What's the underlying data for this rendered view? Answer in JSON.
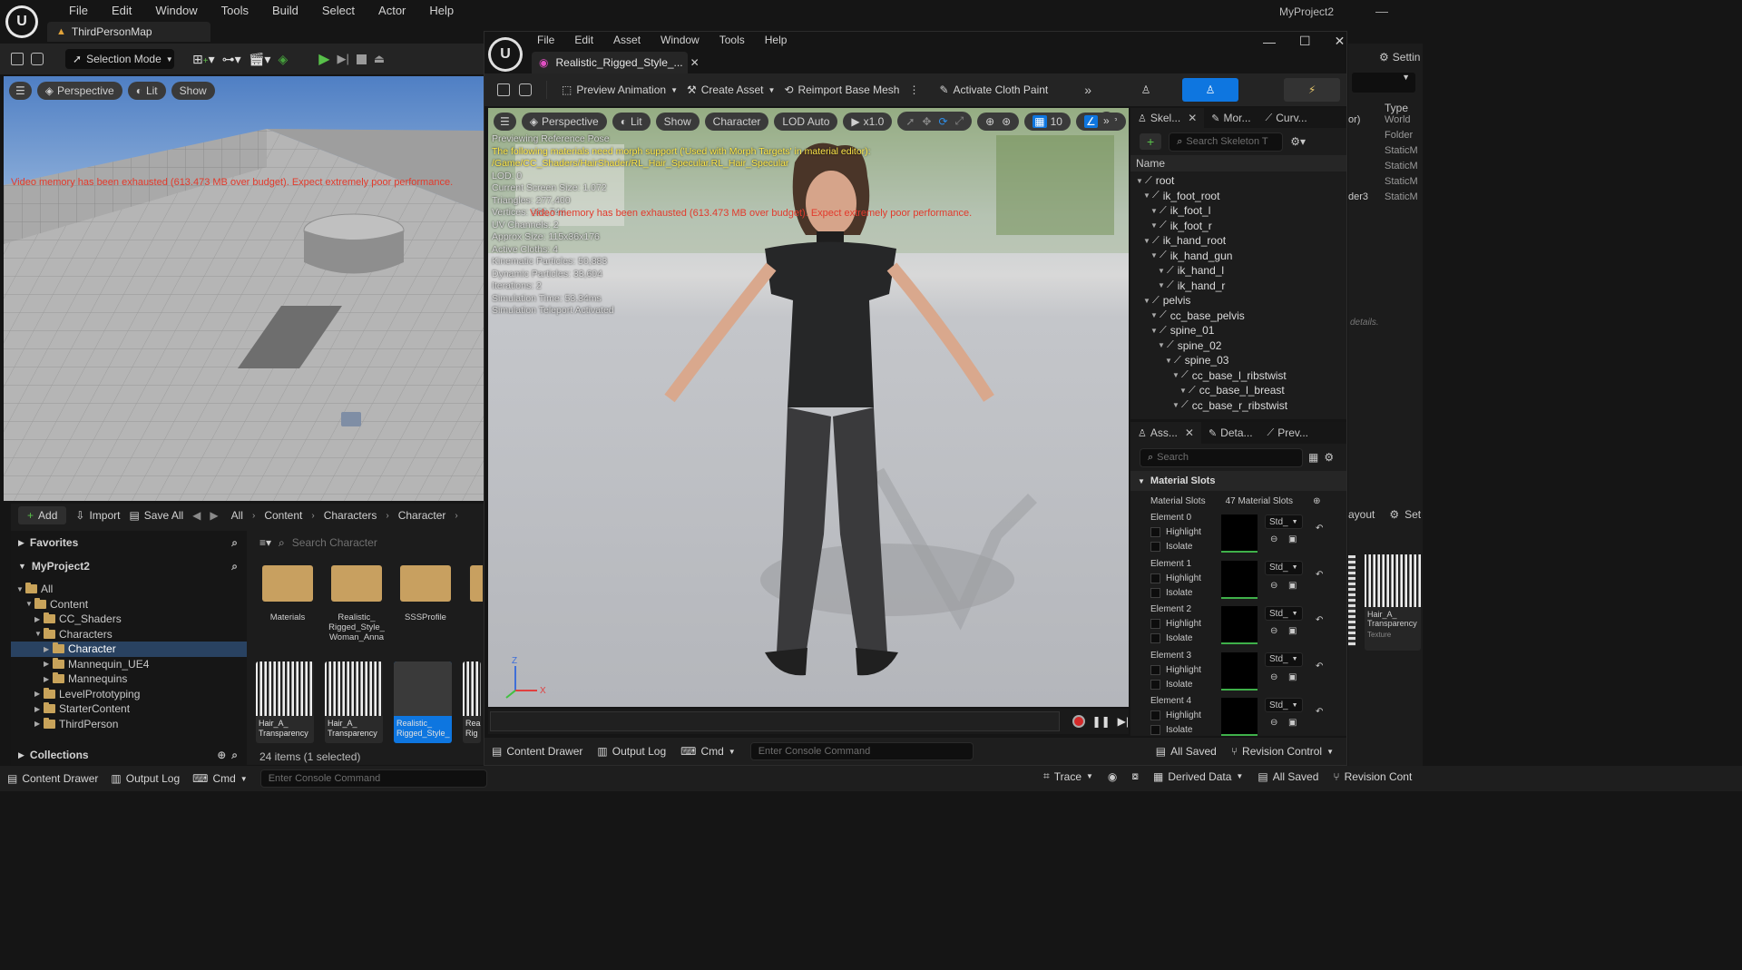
{
  "main_window": {
    "menu": [
      "File",
      "Edit",
      "Window",
      "Tools",
      "Build",
      "Select",
      "Actor",
      "Help"
    ],
    "project_name": "MyProject2",
    "map_tab": "ThirdPersonMap",
    "selection_mode": "Selection Mode",
    "viewport": {
      "perspective": "Perspective",
      "lit": "Lit",
      "show": "Show",
      "warning": "Video memory has been exhausted (613.473 MB over budget). Expect extremely poor performance."
    }
  },
  "content_browser": {
    "add_label": "Add",
    "import_label": "Import",
    "save_all_label": "Save All",
    "breadcrumb": [
      "All",
      "Content",
      "Characters",
      "Character"
    ],
    "favorites_label": "Favorites",
    "project_label": "MyProject2",
    "search_placeholder": "Search Character",
    "tree": [
      {
        "label": "All",
        "depth": 0,
        "open": true
      },
      {
        "label": "Content",
        "depth": 1,
        "open": true
      },
      {
        "label": "CC_Shaders",
        "depth": 2,
        "open": false
      },
      {
        "label": "Characters",
        "depth": 2,
        "open": true
      },
      {
        "label": "Character",
        "depth": 3,
        "open": false,
        "selected": true
      },
      {
        "label": "Mannequin_UE4",
        "depth": 3,
        "open": false
      },
      {
        "label": "Mannequins",
        "depth": 3,
        "open": false
      },
      {
        "label": "LevelPrototyping",
        "depth": 2,
        "open": false
      },
      {
        "label": "StarterContent",
        "depth": 2,
        "open": false
      },
      {
        "label": "ThirdPerson",
        "depth": 2,
        "open": false
      }
    ],
    "folders": [
      "Materials",
      "Realistic_\nRigged_Style_\nWoman_Anna",
      "SSSProfile"
    ],
    "assets": [
      "Hair_A_\nTransparency",
      "Hair_A_\nTransparency",
      "Realistic_\nRigged_Style_",
      "Rea\nRig"
    ],
    "collections_label": "Collections",
    "status": "24 items (1 selected)"
  },
  "bottom_bar": {
    "content_drawer": "Content Drawer",
    "output_log": "Output Log",
    "cmd": "Cmd",
    "console_placeholder": "Enter Console Command",
    "trace": "Trace",
    "derived_data": "Derived Data",
    "all_saved": "All Saved",
    "revision_control": "Revision Cont"
  },
  "right_strip": {
    "settings": "Settin",
    "type_header": "Type",
    "partial_rows": [
      {
        "left": "or)",
        "type": "World"
      },
      {
        "left": "",
        "type": "Folder"
      },
      {
        "left": "",
        "type": "StaticM"
      },
      {
        "left": "",
        "type": "StaticM"
      },
      {
        "left": "",
        "type": "StaticM"
      },
      {
        "left": "der3",
        "type": "StaticM"
      }
    ],
    "details_hint": "details.",
    "layout": "ayout",
    "settings2": "Set",
    "thumb_label": "Hair_A_\nTransparency",
    "thumb_type": "Texture"
  },
  "editor_window": {
    "menu": [
      "File",
      "Edit",
      "Asset",
      "Window",
      "Tools",
      "Help"
    ],
    "tab_title": "Realistic_Rigged_Style_...",
    "toolbar": {
      "preview_animation": "Preview Animation",
      "create_asset": "Create Asset",
      "reimport": "Reimport Base Mesh",
      "cloth_paint": "Activate Cloth Paint"
    },
    "viewport": {
      "perspective": "Perspective",
      "lit": "Lit",
      "show": "Show",
      "character": "Character",
      "lod": "LOD Auto",
      "speed": "x1.0",
      "grid": "10",
      "angle": "10°",
      "stats": [
        {
          "text": "Previewing Reference Pose",
          "color": "#d8d8d8"
        },
        {
          "text": "The following materials need morph support ('Used with Morph Targets' in material editor):",
          "color": "#ffe84a"
        },
        {
          "text": "/Game/CC_Shaders/HairShader/RL_Hair_Specular.RL_Hair_Specular",
          "color": "#ffe84a"
        },
        {
          "text": "LOD: 0",
          "color": "#d8d8d8"
        },
        {
          "text": "Current Screen Size: 1.072",
          "color": "#d8d8d8"
        },
        {
          "text": "Triangles: 277,400",
          "color": "#d8d8d8"
        },
        {
          "text": "Vertices: 160,744",
          "color": "#d8d8d8"
        },
        {
          "text": "UV Channels: 2",
          "color": "#d8d8d8"
        },
        {
          "text": "Approx Size: 115x36x176",
          "color": "#d8d8d8"
        },
        {
          "text": "Active Cloths: 4",
          "color": "#d8d8d8"
        },
        {
          "text": "Kinematic Particles: 50,883",
          "color": "#d8d8d8"
        },
        {
          "text": "Dynamic Particles: 33,604",
          "color": "#d8d8d8"
        },
        {
          "text": "Iterations: 2",
          "color": "#d8d8d8"
        },
        {
          "text": "Simulation Time: 53.34ms",
          "color": "#d8d8d8"
        },
        {
          "text": "Simulation Teleport Activated",
          "color": "#d8d8d8"
        }
      ],
      "warning": "Video memory has been exhausted (613.473 MB over budget). Expect extremely poor performance."
    },
    "skeleton_tree": {
      "tabs": [
        "Skel...",
        "Mor...",
        "Curv..."
      ],
      "search_placeholder": "Search Skeleton T",
      "name_header": "Name",
      "bones": [
        {
          "label": "root",
          "depth": 0
        },
        {
          "label": "ik_foot_root",
          "depth": 1
        },
        {
          "label": "ik_foot_l",
          "depth": 2
        },
        {
          "label": "ik_foot_r",
          "depth": 2
        },
        {
          "label": "ik_hand_root",
          "depth": 1
        },
        {
          "label": "ik_hand_gun",
          "depth": 2
        },
        {
          "label": "ik_hand_l",
          "depth": 3
        },
        {
          "label": "ik_hand_r",
          "depth": 3
        },
        {
          "label": "pelvis",
          "depth": 1
        },
        {
          "label": "cc_base_pelvis",
          "depth": 2
        },
        {
          "label": "spine_01",
          "depth": 2
        },
        {
          "label": "spine_02",
          "depth": 3
        },
        {
          "label": "spine_03",
          "depth": 4
        },
        {
          "label": "cc_base_l_ribstwist",
          "depth": 5
        },
        {
          "label": "cc_base_l_breast",
          "depth": 6
        },
        {
          "label": "cc_base_r_ribstwist",
          "depth": 5
        }
      ]
    },
    "asset_details": {
      "tabs": [
        "Ass...",
        "Deta...",
        "Prev..."
      ],
      "search_placeholder": "Search",
      "section": "Material Slots",
      "slots_label": "Material Slots",
      "slots_count": "47 Material Slots",
      "elements": [
        "Element 0",
        "Element 1",
        "Element 2",
        "Element 3",
        "Element 4"
      ],
      "highlight": "Highlight",
      "isolate": "Isolate",
      "std": "Std_"
    },
    "bottom": {
      "content_drawer": "Content Drawer",
      "output_log": "Output Log",
      "cmd": "Cmd",
      "console_placeholder": "Enter Console Command",
      "all_saved": "All Saved",
      "revision_control": "Revision Control"
    }
  }
}
